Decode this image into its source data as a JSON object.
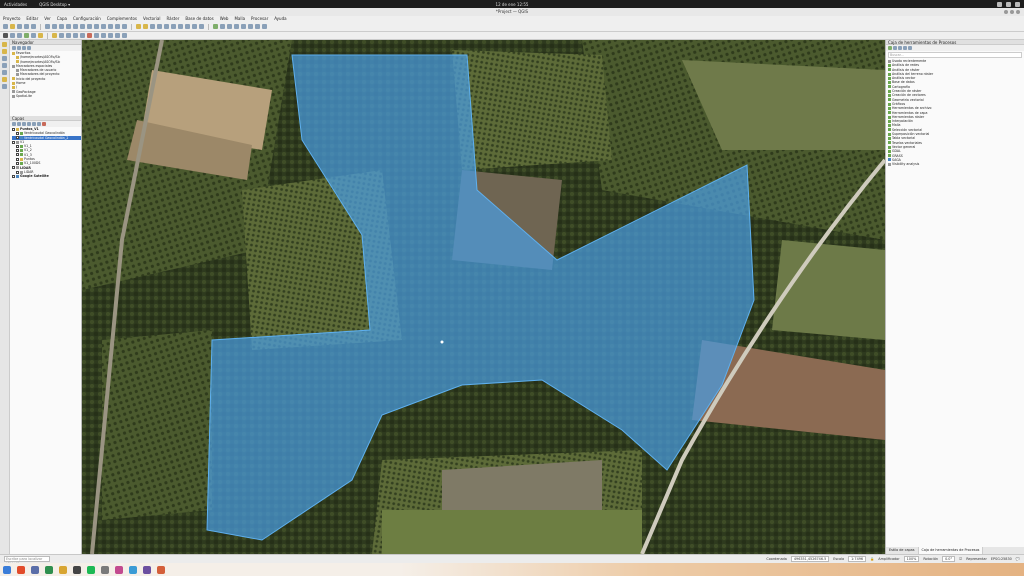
{
  "system": {
    "activities": "Actividades",
    "app_name": "QGIS Desktop ▾",
    "clock": "12 de ene 12:55"
  },
  "window": {
    "title": "*Project — QGIS"
  },
  "menu": [
    "Proyecto",
    "Editar",
    "Ver",
    "Capa",
    "Configuración",
    "Complementos",
    "Vectorial",
    "Ráster",
    "Base de datos",
    "Web",
    "Malla",
    "Procesar",
    "Ayuda"
  ],
  "browser_panel": {
    "title": "Navegador",
    "items": [
      {
        "label": "Favoritos",
        "icon": "star-icon"
      },
      {
        "label": "/home/ecortes/ASOFo/SIc",
        "icon": "folder-icon"
      },
      {
        "label": "/home/ecortes/ASOFo/SIc",
        "icon": "folder-icon"
      },
      {
        "label": "Marcadores espaciales",
        "icon": "bookmark-icon"
      },
      {
        "label": "Marcadores de usuario",
        "icon": "bookmark-icon"
      },
      {
        "label": "Marcadores del proyecto",
        "icon": "bookmark-icon"
      },
      {
        "label": "Inicio del proyecto",
        "icon": "folder-icon"
      },
      {
        "label": "Home",
        "icon": "home-icon"
      },
      {
        "label": "/",
        "icon": "folder-icon"
      },
      {
        "label": "GeoPackage",
        "icon": "database-icon"
      },
      {
        "label": "SpatiaLite",
        "icon": "database-icon"
      }
    ]
  },
  "layers_panel": {
    "title": "Capas",
    "items": [
      {
        "label": "Puntos_V1",
        "icon": "point-layer-icon",
        "checked": true,
        "selected": false
      },
      {
        "label": "Ventricaudal Geocolindón",
        "icon": "polygon-layer-icon",
        "checked": true,
        "selected": false
      },
      {
        "label": "Ventricaudal Geocolindón_2",
        "icon": "polygon-layer-icon",
        "checked": true,
        "selected": true
      },
      {
        "label": "V1",
        "icon": "layer-group-icon",
        "checked": true,
        "selected": false
      },
      {
        "label": "V1_1",
        "icon": "polygon-layer-icon",
        "checked": true,
        "selected": false
      },
      {
        "label": "V1_2",
        "icon": "polygon-layer-icon",
        "checked": true,
        "selected": false
      },
      {
        "label": "V1_3",
        "icon": "polygon-layer-icon",
        "checked": true,
        "selected": false
      },
      {
        "label": "Puntos",
        "icon": "point-layer-icon",
        "checked": false,
        "selected": false
      },
      {
        "label": "V1_100DS",
        "icon": "polygon-layer-icon",
        "checked": false,
        "selected": false
      },
      {
        "label": "LIDAR",
        "icon": "raster-layer-icon",
        "checked": true,
        "selected": false
      },
      {
        "label": "LIDAR",
        "icon": "raster-layer-icon",
        "checked": false,
        "selected": false
      },
      {
        "label": "Google Satellite",
        "icon": "xyz-layer-icon",
        "checked": true,
        "selected": false
      }
    ]
  },
  "processing_panel": {
    "title": "Caja de herramientas de Procesos",
    "search_placeholder": "Buscar...",
    "items": [
      "Usado recientemente",
      "Análisis de redes",
      "Análisis de ráster",
      "Análisis del terreno ráster",
      "Análisis vector",
      "Base de datos",
      "Cartografía",
      "Creación de ráster",
      "Creación de vectores",
      "Geometría vectorial",
      "Gráficos",
      "Herramientas de archivo",
      "Herramientas de capa",
      "Herramientas ráster",
      "Interpolación",
      "Malla",
      "Selección vectorial",
      "Superposición vectorial",
      "Tabla vectorial",
      "Teselas vectoriales",
      "Vector general",
      "GDAL",
      "GRASS",
      "SAGA",
      "Visibility analysis"
    ],
    "tabs": [
      "Estilo de capas",
      "Caja de herramientas de Procesos"
    ]
  },
  "statusbar": {
    "locator_placeholder": "Escribe para localizar (Ctrl+K)",
    "coordinate_label": "Coordenada",
    "coordinate": "496351,4526746.5",
    "scale_label": "Escala",
    "scale": "1:7496",
    "magnifier_label": "Amplificador",
    "magnifier": "100%",
    "rotation_label": "Rotación",
    "rotation": "0.0°",
    "render_label": "Representar",
    "crs": "EPSG:25830"
  },
  "colors": {
    "polygon_fill": "#4a9de0",
    "selection": "#3874c8"
  }
}
